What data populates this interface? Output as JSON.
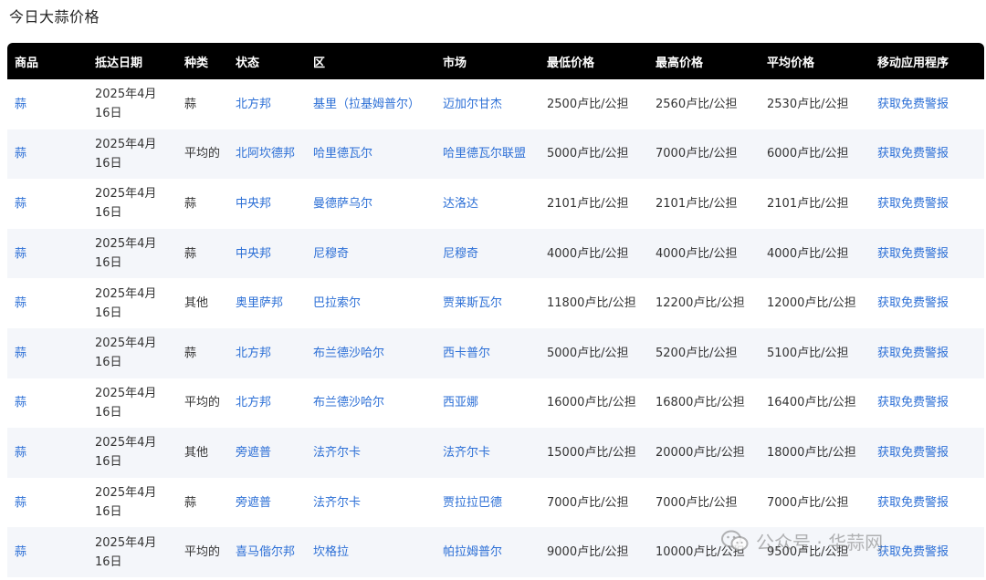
{
  "page": {
    "title": "今日大蒜价格"
  },
  "table": {
    "headers": [
      "商品",
      "抵达日期",
      "种类",
      "状态",
      "区",
      "市场",
      "最低价格",
      "最高价格",
      "平均价格",
      "移动应用程序"
    ],
    "rows": [
      {
        "commodity": "蒜",
        "date": "2025年4月16日",
        "variety": "蒜",
        "state": "北方邦",
        "district": "基里（拉基姆普尔）",
        "market": "迈加尔甘杰",
        "min": "2500卢比/公担",
        "max": "2560卢比/公担",
        "avg": "2530卢比/公担",
        "app": "获取免费警报"
      },
      {
        "commodity": "蒜",
        "date": "2025年4月16日",
        "variety": "平均的",
        "state": "北阿坎德邦",
        "district": "哈里德瓦尔",
        "market": "哈里德瓦尔联盟",
        "min": "5000卢比/公担",
        "max": "7000卢比/公担",
        "avg": "6000卢比/公担",
        "app": "获取免费警报"
      },
      {
        "commodity": "蒜",
        "date": "2025年4月16日",
        "variety": "蒜",
        "state": "中央邦",
        "district": "曼德萨乌尔",
        "market": "达洛达",
        "min": "2101卢比/公担",
        "max": "2101卢比/公担",
        "avg": "2101卢比/公担",
        "app": "获取免费警报"
      },
      {
        "commodity": "蒜",
        "date": "2025年4月16日",
        "variety": "蒜",
        "state": "中央邦",
        "district": "尼穆奇",
        "market": "尼穆奇",
        "min": "4000卢比/公担",
        "max": "4000卢比/公担",
        "avg": "4000卢比/公担",
        "app": "获取免费警报"
      },
      {
        "commodity": "蒜",
        "date": "2025年4月16日",
        "variety": "其他",
        "state": "奥里萨邦",
        "district": "巴拉索尔",
        "market": "贾莱斯瓦尔",
        "min": "11800卢比/公担",
        "max": "12200卢比/公担",
        "avg": "12000卢比/公担",
        "app": "获取免费警报"
      },
      {
        "commodity": "蒜",
        "date": "2025年4月16日",
        "variety": "蒜",
        "state": "北方邦",
        "district": "布兰德沙哈尔",
        "market": "西卡普尔",
        "min": "5000卢比/公担",
        "max": "5200卢比/公担",
        "avg": "5100卢比/公担",
        "app": "获取免费警报"
      },
      {
        "commodity": "蒜",
        "date": "2025年4月16日",
        "variety": "平均的",
        "state": "北方邦",
        "district": "布兰德沙哈尔",
        "market": "西亚娜",
        "min": "16000卢比/公担",
        "max": "16800卢比/公担",
        "avg": "16400卢比/公担",
        "app": "获取免费警报"
      },
      {
        "commodity": "蒜",
        "date": "2025年4月16日",
        "variety": "其他",
        "state": "旁遮普",
        "district": "法齐尔卡",
        "market": "法齐尔卡",
        "min": "15000卢比/公担",
        "max": "20000卢比/公担",
        "avg": "18000卢比/公担",
        "app": "获取免费警报"
      },
      {
        "commodity": "蒜",
        "date": "2025年4月16日",
        "variety": "蒜",
        "state": "旁遮普",
        "district": "法齐尔卡",
        "market": "贾拉拉巴德",
        "min": "7000卢比/公担",
        "max": "7000卢比/公担",
        "avg": "7000卢比/公担",
        "app": "获取免费警报"
      },
      {
        "commodity": "蒜",
        "date": "2025年4月16日",
        "variety": "平均的",
        "state": "喜马偕尔邦",
        "district": "坎格拉",
        "market": "帕拉姆普尔",
        "min": "9000卢比/公担",
        "max": "10000卢比/公担",
        "avg": "9500卢比/公担",
        "app": "获取免费警报"
      }
    ]
  },
  "watermark": {
    "text": "公众号 · 华蒜网"
  }
}
